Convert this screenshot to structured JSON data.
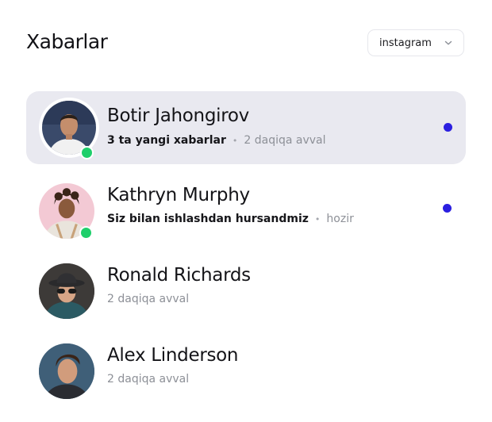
{
  "header": {
    "title": "Xabarlar",
    "source_select": {
      "value": "instagram"
    }
  },
  "colors": {
    "online": "#1fcf6b",
    "unread": "#2b1fe0",
    "active_row_bg": "#e9e9f0"
  },
  "conversations": [
    {
      "name": "Botir Jahongirov",
      "message": "3 ta yangi xabarlar",
      "separator": "•",
      "time": "2 daqiqa avval",
      "online": true,
      "unread": true,
      "active": true
    },
    {
      "name": "Kathryn Murphy",
      "message": "Siz bilan ishlashdan hursandmiz",
      "separator": "•",
      "time": "hozir",
      "online": true,
      "unread": true,
      "active": false
    },
    {
      "name": "Ronald Richards",
      "message": "",
      "time": "2 daqiqa avval",
      "online": false,
      "unread": false,
      "active": false
    },
    {
      "name": "Alex Linderson",
      "message": "",
      "time": "2 daqiqa avval",
      "online": false,
      "unread": false,
      "active": false
    }
  ]
}
